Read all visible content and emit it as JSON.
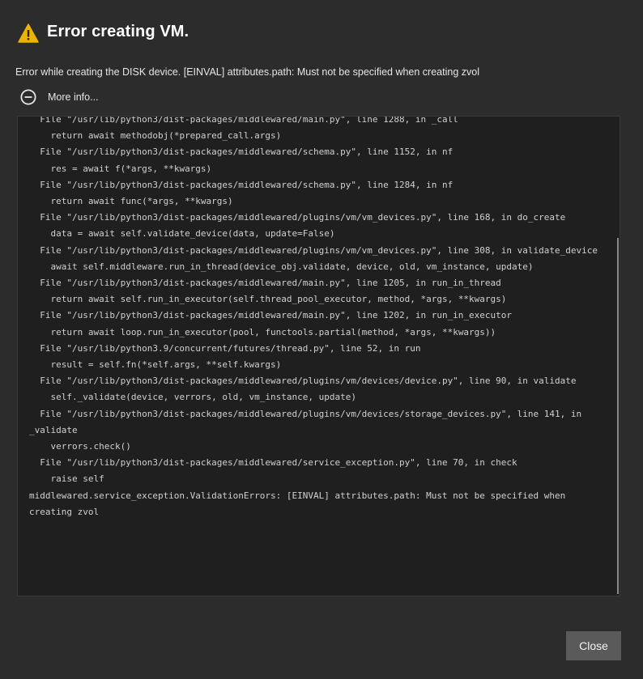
{
  "dialog": {
    "title": "Error creating VM.",
    "message": "Error while creating the DISK device. [EINVAL] attributes.path: Must not be specified when creating zvol",
    "more_info_label": "More info...",
    "close_label": "Close",
    "icons": {
      "title_icon": "warning-icon",
      "more_info_icon": "collapse-minus-icon"
    },
    "colors": {
      "warning": "#f0b400",
      "background": "#2c2c2c",
      "trace_background": "#1f1f1f"
    },
    "traceback": "  File \"/usr/lib/python3/dist-packages/middlewared/main.py\", line 1288, in _call\n    return await methodobj(*prepared_call.args)\n  File \"/usr/lib/python3/dist-packages/middlewared/schema.py\", line 1152, in nf\n    res = await f(*args, **kwargs)\n  File \"/usr/lib/python3/dist-packages/middlewared/schema.py\", line 1284, in nf\n    return await func(*args, **kwargs)\n  File \"/usr/lib/python3/dist-packages/middlewared/plugins/vm/vm_devices.py\", line 168, in do_create\n    data = await self.validate_device(data, update=False)\n  File \"/usr/lib/python3/dist-packages/middlewared/plugins/vm/vm_devices.py\", line 308, in validate_device\n    await self.middleware.run_in_thread(device_obj.validate, device, old, vm_instance, update)\n  File \"/usr/lib/python3/dist-packages/middlewared/main.py\", line 1205, in run_in_thread\n    return await self.run_in_executor(self.thread_pool_executor, method, *args, **kwargs)\n  File \"/usr/lib/python3/dist-packages/middlewared/main.py\", line 1202, in run_in_executor\n    return await loop.run_in_executor(pool, functools.partial(method, *args, **kwargs))\n  File \"/usr/lib/python3.9/concurrent/futures/thread.py\", line 52, in run\n    result = self.fn(*self.args, **self.kwargs)\n  File \"/usr/lib/python3/dist-packages/middlewared/plugins/vm/devices/device.py\", line 90, in validate\n    self._validate(device, verrors, old, vm_instance, update)\n  File \"/usr/lib/python3/dist-packages/middlewared/plugins/vm/devices/storage_devices.py\", line 141, in _validate\n    verrors.check()\n  File \"/usr/lib/python3/dist-packages/middlewared/service_exception.py\", line 70, in check\n    raise self\nmiddlewared.service_exception.ValidationErrors: [EINVAL] attributes.path: Must not be specified when creating zvol"
  }
}
